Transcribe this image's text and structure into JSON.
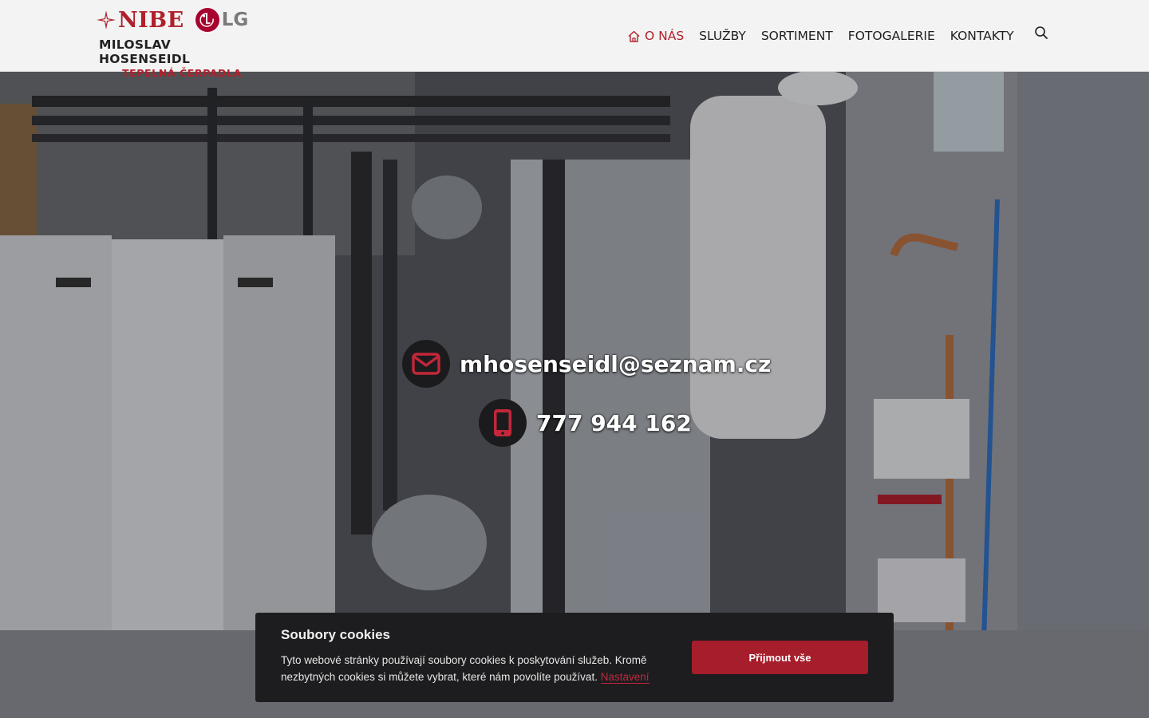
{
  "brand": {
    "nibe": "NIBE",
    "lg": "LG",
    "name": "MILOSLAV HOSENSEIDL",
    "subtitle": "TEPELNÁ ČERPADLA"
  },
  "nav": {
    "items": [
      {
        "label": "O NÁS",
        "active": true,
        "icon": "home-icon"
      },
      {
        "label": "SLUŽBY"
      },
      {
        "label": "SORTIMENT"
      },
      {
        "label": "FOTOGALERIE"
      },
      {
        "label": "KONTAKTY"
      }
    ],
    "search_icon": "search-icon"
  },
  "hero": {
    "email": "mhosenseidl@seznam.cz",
    "phone": "777 944 162",
    "email_icon": "envelope-icon",
    "phone_icon": "mobile-phone-icon"
  },
  "cookie": {
    "title": "Soubory cookies",
    "text": "Tyto webové stránky používají soubory cookies k poskytování služeb. Kromě nezbytných cookies si můžete vybrat, které nám povolíte používat.",
    "settings_link": "Nastavení",
    "accept_label": "Přijmout vše"
  },
  "colors": {
    "accent": "#b0202b",
    "header_bg": "#f3f3f3",
    "banner_bg": "#1d1d1f",
    "button_bg": "#a61d2b"
  }
}
